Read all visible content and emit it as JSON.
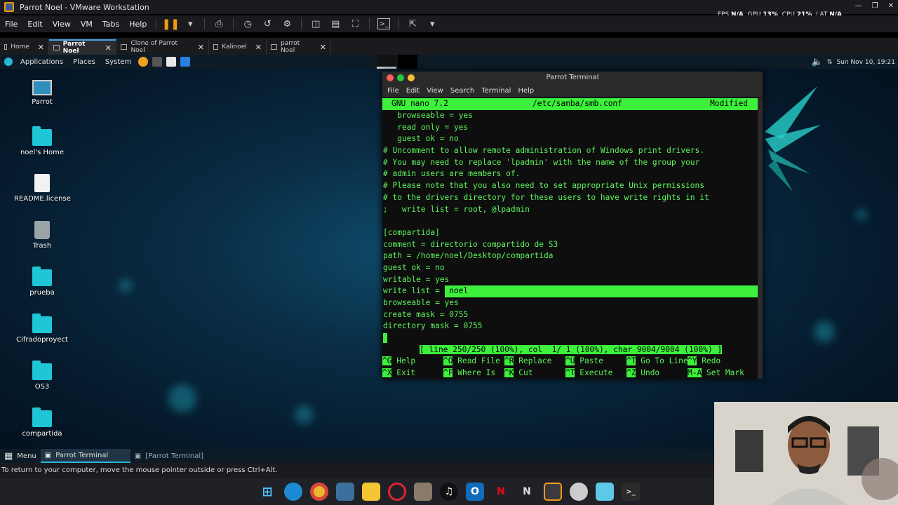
{
  "vmware": {
    "title": "Parrot Noel - VMware Workstation",
    "perf": {
      "fps_label": "FPS",
      "fps_value": "N/A",
      "gpu_label": "GPU",
      "gpu_value": "13%",
      "cpu_label": "CPU",
      "cpu_value": "21%",
      "lat_label": "LAT",
      "lat_value": "N/A"
    },
    "menu": [
      "File",
      "Edit",
      "View",
      "VM",
      "Tabs",
      "Help"
    ],
    "tabs": [
      {
        "label": "Home"
      },
      {
        "label": "Parrot Noel"
      },
      {
        "label": "Clone of Parrot Noel"
      },
      {
        "label": "Kalinoel"
      },
      {
        "label": "parrot Noel"
      }
    ],
    "hint": "To return to your computer, move the mouse pointer outside or press Ctrl+Alt."
  },
  "guest": {
    "panel": {
      "applications": "Applications",
      "places": "Places",
      "system": "System",
      "clock": "Sun Nov 10, 19:21"
    },
    "desktop_icons": [
      {
        "label": "Parrot"
      },
      {
        "label": "noel's Home"
      },
      {
        "label": "README.license"
      },
      {
        "label": "Trash"
      },
      {
        "label": "prueba"
      },
      {
        "label": "Cifradoproyect"
      },
      {
        "label": "OS3"
      },
      {
        "label": "compartida"
      }
    ],
    "bottom_panel": {
      "menu": "Menu",
      "task1": "Parrot Terminal",
      "task2": "[Parrot Terminal]"
    }
  },
  "terminal": {
    "title": "Parrot Terminal",
    "menu": [
      "File",
      "Edit",
      "View",
      "Search",
      "Terminal",
      "Help"
    ],
    "nano_header": {
      "version": "GNU nano 7.2",
      "file": "/etc/samba/smb.conf",
      "state": "Modified"
    },
    "lines": [
      "   browseable = yes",
      "   read only = yes",
      "   guest ok = no",
      "# Uncomment to allow remote administration of Windows print drivers.",
      "# You may need to replace 'lpadmin' with the name of the group your",
      "# admin users are members of.",
      "# Please note that you also need to set appropriate Unix permissions",
      "# to the drivers directory for these users to have write rights in it",
      ";   write list = root, @lpadmin",
      "",
      "[compartida]",
      "comment = directorio compartido de S3",
      "path = /home/noel/Desktop/compartida",
      "guest ok = no",
      "writable = yes"
    ],
    "selected_line": {
      "prefix": "write list = ",
      "highlight": " noel"
    },
    "after_lines": [
      "browseable = yes",
      "create mask = 0755",
      "directory mask = 0755"
    ],
    "status": "[ line 250/250 (100%), col  1/ 1 (100%), char 9004/9004 (100%) ]",
    "shortcuts_row1": [
      {
        "key": "^G",
        "label": " Help"
      },
      {
        "key": "^O",
        "label": " Read File"
      },
      {
        "key": "^R",
        "label": " Replace"
      },
      {
        "key": "^U",
        "label": " Paste"
      },
      {
        "key": "^T",
        "label": " Go To Line"
      },
      {
        "key": "^Y",
        "label": " Redo"
      }
    ],
    "shortcuts_row2": [
      {
        "key": "^X",
        "label": " Exit"
      },
      {
        "key": "^F",
        "label": " Where Is"
      },
      {
        "key": "^K",
        "label": " Cut"
      },
      {
        "key": "^T",
        "label": " Execute"
      },
      {
        "key": "^Z",
        "label": " Undo"
      },
      {
        "key": "M-A",
        "label": " Set Mark"
      }
    ]
  },
  "colors": {
    "nano_green": "#3cf03c",
    "folder_cyan": "#1fc6d6",
    "vmware_accent": "#f39c12"
  }
}
